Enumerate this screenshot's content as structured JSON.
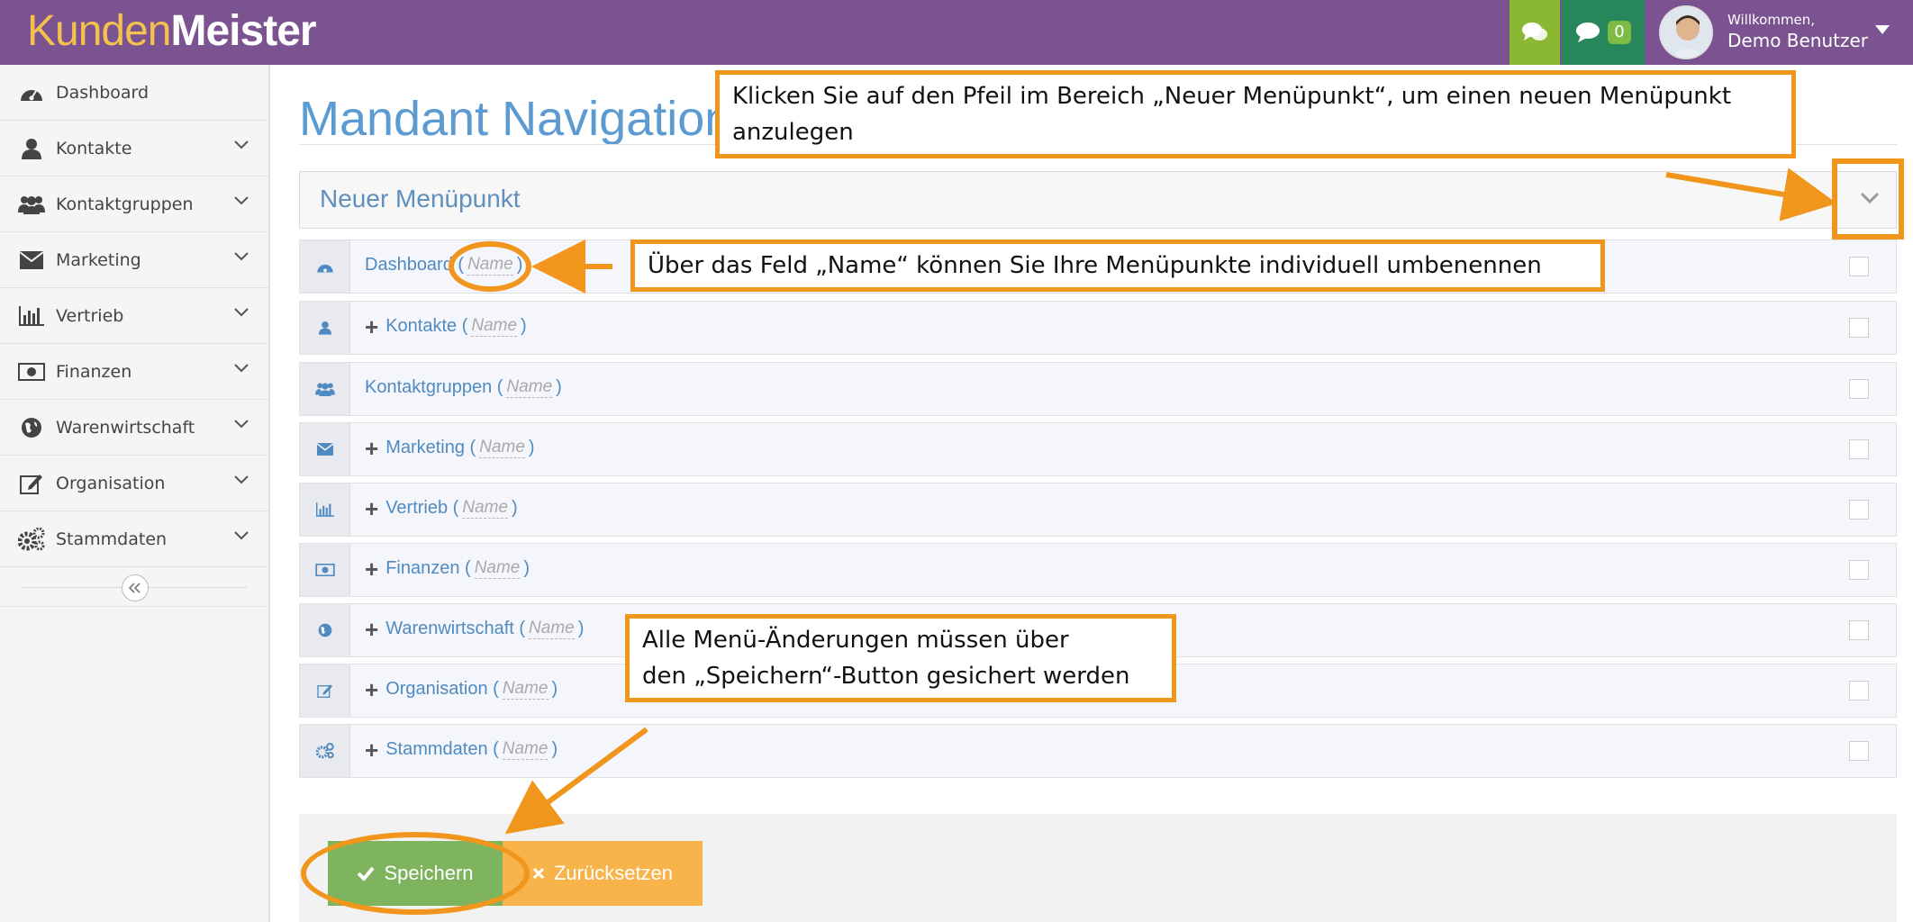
{
  "header": {
    "logo_part1": "Kunden",
    "logo_part2": "Meister",
    "messages_count": "0",
    "welcome_label": "Willkommen,",
    "user_name": "Demo Benutzer"
  },
  "sidebar": {
    "items": [
      {
        "label": "Dashboard",
        "icon": "dashboard-icon"
      },
      {
        "label": "Kontakte",
        "icon": "user-icon"
      },
      {
        "label": "Kontaktgruppen",
        "icon": "users-icon"
      },
      {
        "label": "Marketing",
        "icon": "envelope-icon"
      },
      {
        "label": "Vertrieb",
        "icon": "bar-chart-icon"
      },
      {
        "label": "Finanzen",
        "icon": "money-icon"
      },
      {
        "label": "Warenwirtschaft",
        "icon": "globe-icon"
      },
      {
        "label": "Organisation",
        "icon": "edit-icon"
      },
      {
        "label": "Stammdaten",
        "icon": "gears-icon"
      }
    ]
  },
  "main": {
    "title": "Mandant Navigation",
    "new_item_label": "Neuer Menüpunkt",
    "name_placeholder": "Name",
    "rows": [
      {
        "label": "Dashboard",
        "has_children": false
      },
      {
        "label": "Kontakte",
        "has_children": true
      },
      {
        "label": "Kontaktgruppen",
        "has_children": false
      },
      {
        "label": "Marketing",
        "has_children": true
      },
      {
        "label": "Vertrieb",
        "has_children": true
      },
      {
        "label": "Finanzen",
        "has_children": true
      },
      {
        "label": "Warenwirtschaft",
        "has_children": true
      },
      {
        "label": "Organisation",
        "has_children": true
      },
      {
        "label": "Stammdaten",
        "has_children": true
      }
    ],
    "save_label": "Speichern",
    "reset_label": "Zurücksetzen"
  },
  "callouts": {
    "new_item": "Klicken Sie auf den Pfeil im Bereich „Neuer Menüpunkt“, um einen neuen Menüpunkt anzulegen",
    "name_field": "Über das Feld „Name“ können Sie Ihre Menüpunkte individuell umbenennen",
    "save_line1": "Alle Menü-Änderungen müssen über",
    "save_line2": "den „Speichern“-Button gesichert werden"
  },
  "colors": {
    "header_bg": "#7b5390",
    "logo_accent": "#f2c14e",
    "link_blue": "#4f8ac0",
    "callout_orange": "#f0961d",
    "save_green": "#7fb45e",
    "reset_orange": "#f8b34b"
  }
}
